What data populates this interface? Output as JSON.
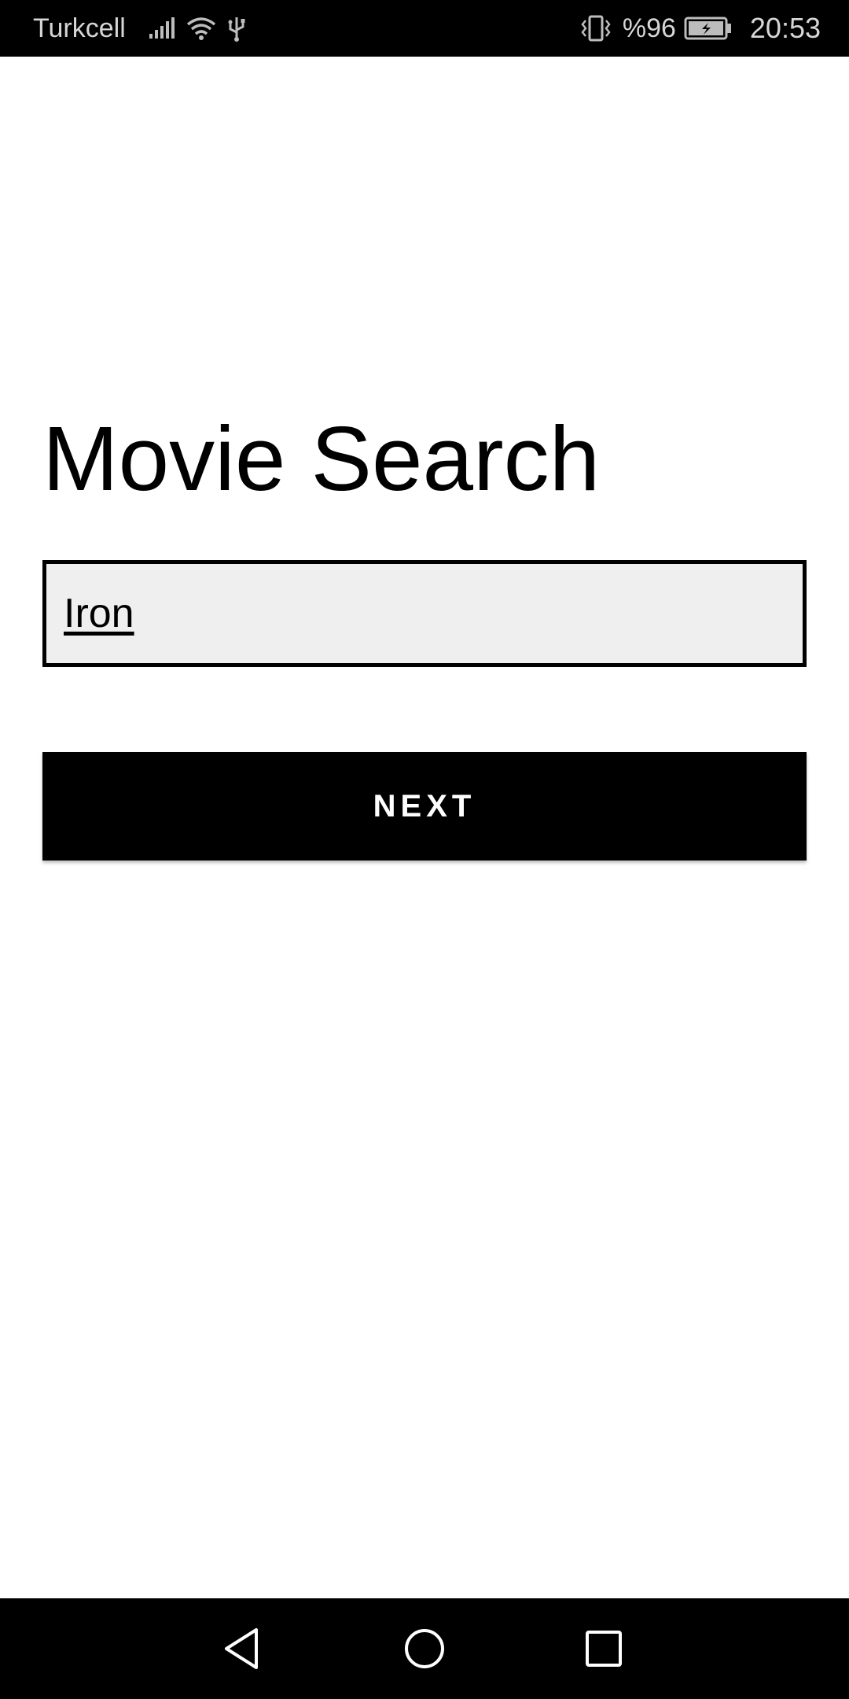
{
  "status_bar": {
    "carrier": "Turkcell",
    "battery_percent": "%96",
    "time": "20:53",
    "icons": [
      "signal-icon",
      "wifi-icon",
      "usb-icon",
      "vibrate-icon",
      "battery-charging-icon"
    ]
  },
  "main": {
    "title": "Movie Search",
    "search_value": "Iron",
    "next_label": "NEXT"
  },
  "nav_bar": {
    "icons": [
      "back-icon",
      "home-icon",
      "recents-icon"
    ]
  },
  "colors": {
    "background": "#ffffff",
    "bars": "#000000",
    "input_background": "#efefef",
    "button_background": "#000000",
    "button_text": "#ffffff"
  }
}
